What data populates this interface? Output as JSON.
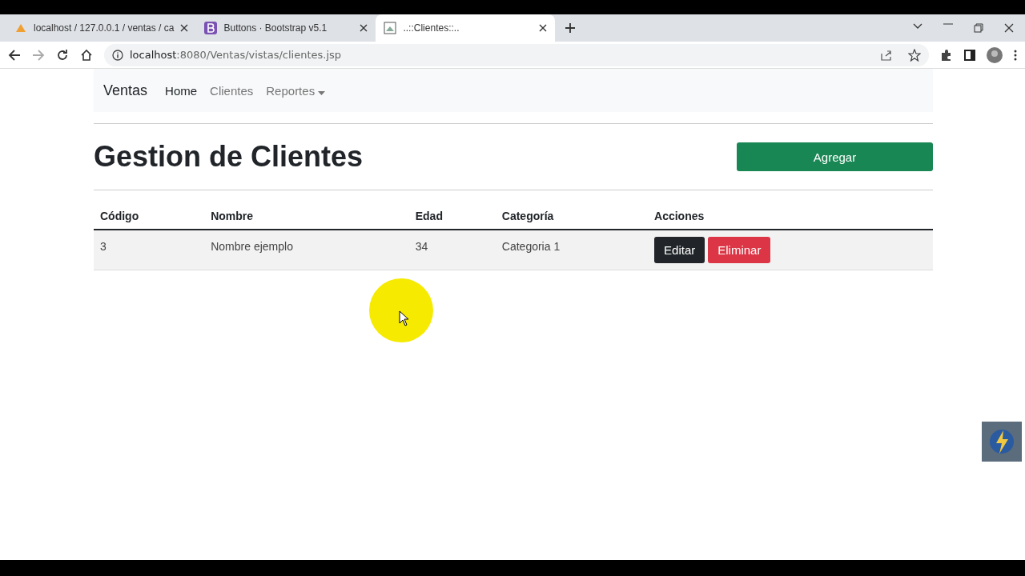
{
  "browser": {
    "tabs": [
      {
        "title": "localhost / 127.0.0.1 / ventas / ca",
        "selected": false
      },
      {
        "title": "Buttons · Bootstrap v5.1",
        "selected": false
      },
      {
        "title": "..::Clientes::..",
        "selected": true
      }
    ],
    "address": {
      "host": "localhost",
      "path": ":8080/Ventas/vistas/clientes.jsp"
    }
  },
  "navbar": {
    "brand": "Ventas",
    "links": [
      {
        "label": "Home",
        "selected": true,
        "dropdown": false
      },
      {
        "label": "Clientes",
        "selected": false,
        "dropdown": false
      },
      {
        "label": "Reportes",
        "selected": false,
        "dropdown": true
      }
    ]
  },
  "page": {
    "title": "Gestion de Clientes",
    "add_button": "Agregar"
  },
  "table": {
    "columns": [
      "Código",
      "Nombre",
      "Edad",
      "Categoría",
      "Acciones"
    ],
    "rows": [
      {
        "cells": [
          "3",
          "Nombre ejemplo",
          "34",
          "Categoria 1"
        ],
        "actions": [
          {
            "label": "Editar",
            "kind": "dark"
          },
          {
            "label": "Eliminar",
            "kind": "danger"
          }
        ]
      }
    ]
  }
}
